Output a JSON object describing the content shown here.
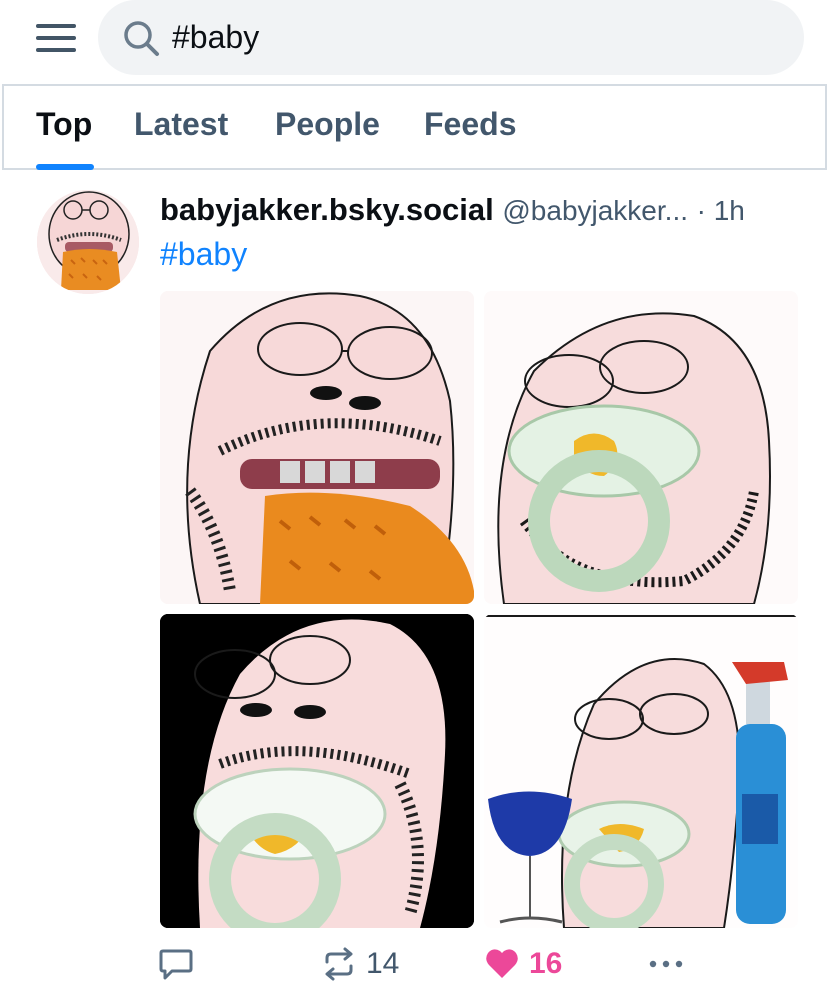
{
  "search": {
    "query": "#baby"
  },
  "tabs": [
    {
      "label": "Top"
    },
    {
      "label": "Latest"
    },
    {
      "label": "People"
    },
    {
      "label": "Feeds"
    }
  ],
  "post": {
    "display_name": "babyjakker.bsky.social",
    "handle": "@babyjakker...",
    "time": "· 1h",
    "text": "#baby",
    "actions": {
      "reposts": "14",
      "likes": "16"
    }
  },
  "colors": {
    "accent": "#1083fe",
    "like": "#ec4899",
    "muted": "#42576c"
  },
  "icons": [
    "menu-icon",
    "search-icon",
    "reply-icon",
    "repost-icon",
    "heart-icon",
    "more-icon"
  ]
}
